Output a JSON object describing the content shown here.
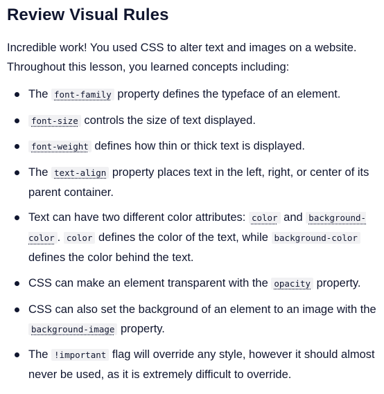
{
  "title": "Review Visual Rules",
  "intro": "Incredible work! You used CSS to alter text and images on a website. Throughout this lesson, you learned concepts including:",
  "bullets": [
    {
      "t1": "The ",
      "c1": "font-family",
      "t2": " property defines the typeface of an element."
    },
    {
      "c1": "font-size",
      "t2": " controls the size of text displayed."
    },
    {
      "c1": "font-weight",
      "t2": " defines how thin or thick text is displayed."
    },
    {
      "t1": "The ",
      "c1": "text-align",
      "t2": " property places text in the left, right, or center of its parent container."
    },
    {
      "t1": "Text can have two different color attributes: ",
      "c1": "color",
      "t2": " and ",
      "c2": "background-color",
      "t3": ". ",
      "c3": "color",
      "t4": " defines the color of the text, while ",
      "c4": "background-color",
      "t5": " defines the color behind the text."
    },
    {
      "t1": "CSS can make an element transparent with the ",
      "c1": "opacity",
      "t2": " property."
    },
    {
      "t1": "CSS can also set the background of an element to an image with the ",
      "c1": "background-image",
      "t2": " property."
    },
    {
      "t1": "The ",
      "c1": "!important",
      "t2": " flag will override any style, however it should almost never be used, as it is extremely difficult to override."
    }
  ]
}
